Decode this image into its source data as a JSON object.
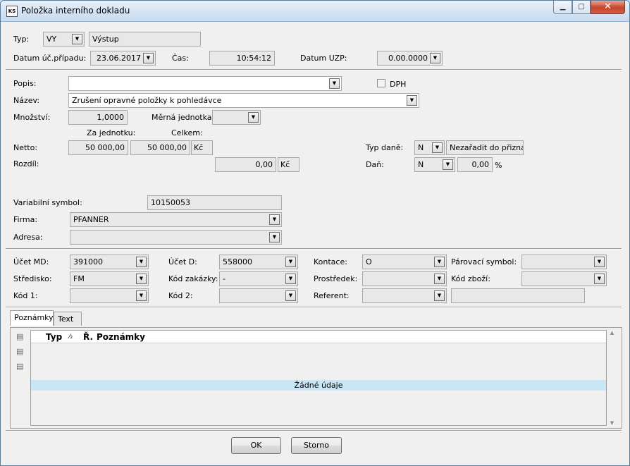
{
  "window": {
    "title": "Položka interního dokladu",
    "icon_text": "KS"
  },
  "header": {
    "typ_label": "Typ:",
    "typ_value": "VY",
    "typ_name": "Výstup",
    "datum_label": "Datum úč.případu:",
    "datum_value": "23.06.2017",
    "cas_label": "Čas:",
    "cas_value": "10:54:12",
    "uzp_label": "Datum UZP:",
    "uzp_value": "0.00.0000"
  },
  "item": {
    "popis_label": "Popis:",
    "popis_value": "",
    "dph_label": "DPH",
    "dph_checked": false,
    "nazev_label": "Název:",
    "nazev_value": "Zrušení opravné položky k pohledávce",
    "mnozstvi_label": "Množství:",
    "mnozstvi_value": "1,0000",
    "mj_label": "Měrná jednotka:",
    "mj_value": "",
    "za_jednotku_label": "Za jednotku:",
    "celkem_label": "Celkem:",
    "netto_label": "Netto:",
    "netto_unit": "50 000,00",
    "netto_total": "50 000,00",
    "netto_currency": "Kč",
    "rozdil_label": "Rozdíl:",
    "rozdil_value": "0,00",
    "rozdil_currency": "Kč",
    "typ_dane_label": "Typ daně:",
    "typ_dane_value": "N",
    "typ_dane_text": "Nezařadit do přiznání",
    "dan_label": "Daň:",
    "dan_value": "N",
    "dan_percent": "0,00",
    "percent_sign": "%"
  },
  "partner": {
    "vs_label": "Variabilní symbol:",
    "vs_value": "10150053",
    "firma_label": "Firma:",
    "firma_value": "PFANNER",
    "adresa_label": "Adresa:",
    "adresa_value": ""
  },
  "accounting": {
    "ucet_md_label": "Účet MD:",
    "ucet_md_value": "391000",
    "ucet_d_label": "Účet D:",
    "ucet_d_value": "558000",
    "kontace_label": "Kontace:",
    "kontace_value": "O",
    "parovaci_label": "Párovací symbol:",
    "parovaci_value": "",
    "stredisko_label": "Středisko:",
    "stredisko_value": "FM",
    "kod_zakazky_label": "Kód zakázky:",
    "kod_zakazky_value": "-",
    "prostredek_label": "Prostředek:",
    "prostredek_value": "",
    "kod_zbozi_label": "Kód zboží:",
    "kod_zbozi_value": "",
    "kod1_label": "Kód 1:",
    "kod1_value": "",
    "kod2_label": "Kód 2:",
    "kod2_value": "",
    "referent_label": "Referent:",
    "referent_value": "",
    "referent_name": ""
  },
  "tabs": [
    {
      "label": "Poznámky",
      "active": true
    },
    {
      "label": "Text",
      "active": false
    }
  ],
  "notes": {
    "col_typ": "Typ",
    "col_sort": "⁄₂",
    "col_r": "Ř.",
    "col_poznamky": "Poznámky",
    "empty_text": "Žádné údaje"
  },
  "buttons": {
    "ok": "OK",
    "storno": "Storno"
  },
  "icons": {
    "dropdown": "dropdown-arrow-icon",
    "add": "add-note-icon",
    "edit": "edit-note-icon",
    "delete": "delete-note-icon"
  }
}
